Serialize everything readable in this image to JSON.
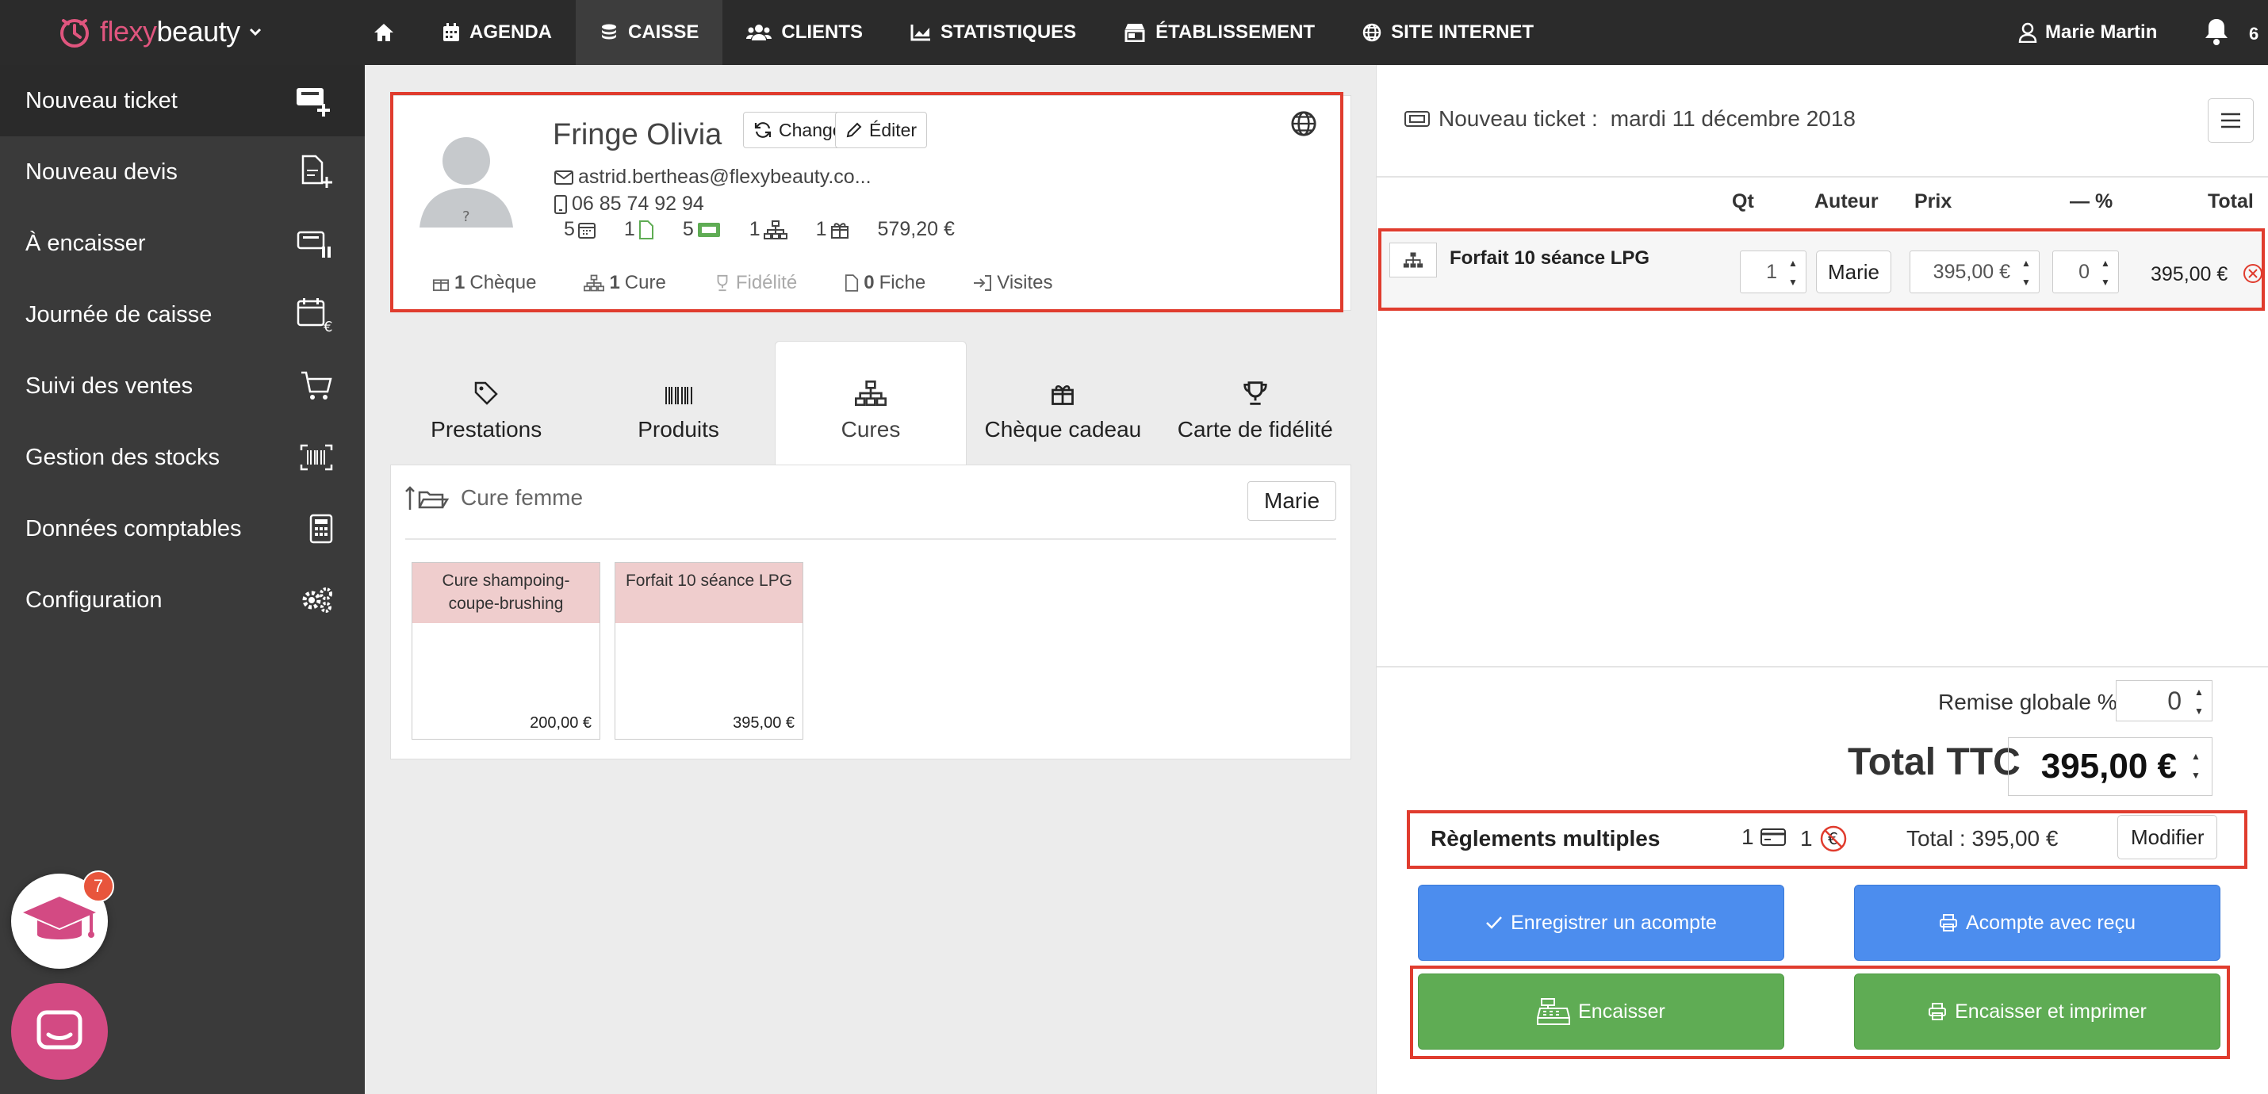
{
  "brand": {
    "logo_text_accent": "flexy",
    "logo_text_main": "beauty"
  },
  "nav": {
    "items": [
      {
        "label": "",
        "icon": "home-icon"
      },
      {
        "label": "AGENDA",
        "icon": "calendar-icon"
      },
      {
        "label": "CAISSE",
        "icon": "coins-icon",
        "active": true
      },
      {
        "label": "CLIENTS",
        "icon": "users-icon"
      },
      {
        "label": "STATISTIQUES",
        "icon": "chart-icon"
      },
      {
        "label": "ÉTABLISSEMENT",
        "icon": "store-icon"
      },
      {
        "label": "SITE INTERNET",
        "icon": "globe-icon"
      }
    ]
  },
  "user": {
    "name": "Marie Martin",
    "notifications": "6"
  },
  "sidebar": {
    "items": [
      {
        "label": "Nouveau ticket"
      },
      {
        "label": "Nouveau devis"
      },
      {
        "label": "À encaisser"
      },
      {
        "label": "Journée de caisse"
      },
      {
        "label": "Suivi des ventes"
      },
      {
        "label": "Gestion des stocks"
      },
      {
        "label": "Données comptables"
      },
      {
        "label": "Configuration"
      }
    ]
  },
  "client": {
    "name": "Fringe Olivia",
    "change_label": "Changer",
    "edit_label": "Éditer",
    "email": "astrid.bertheas@flexybeauty.co...",
    "phone": "06 85 74 92 94",
    "stats": {
      "appointments": "5",
      "documents": "1",
      "tickets": "5",
      "cures": "1",
      "gifts": "1",
      "amount": "579,20 €"
    },
    "links": {
      "cheque_count": "1",
      "cheque": "Chèque",
      "cure_count": "1",
      "cure": "Cure",
      "fidelite": "Fidélité",
      "fiche_count": "0",
      "fiche": "Fiche",
      "visites": "Visites"
    }
  },
  "tabs": [
    {
      "label": "Prestations"
    },
    {
      "label": "Produits"
    },
    {
      "label": "Cures"
    },
    {
      "label": "Chèque cadeau"
    },
    {
      "label": "Carte de fidélité"
    }
  ],
  "cures": {
    "folder": "Cure femme",
    "staff": "Marie",
    "products": [
      {
        "name": "Cure shampoing-coupe-brushing",
        "price": "200,00 €"
      },
      {
        "name": "Forfait 10 séance LPG",
        "price": "395,00 €"
      }
    ]
  },
  "ticket": {
    "title": "Nouveau ticket :",
    "date": "mardi 11 décembre 2018",
    "columns": {
      "qt": "Qt",
      "auteur": "Auteur",
      "prix": "Prix",
      "remise": "— %",
      "total": "Total"
    },
    "lines": [
      {
        "name": "Forfait 10 séance LPG",
        "qty": "1",
        "author": "Marie",
        "price": "395,00 €",
        "discount": "0",
        "total": "395,00 €"
      }
    ],
    "remise_label": "Remise globale %",
    "remise_value": "0",
    "total_label": "Total TTC",
    "total_value": "395,00 €",
    "reglements": {
      "label": "Règlements multiples",
      "card_count": "1",
      "no_cash_count": "1",
      "total": "Total : 395,00 €",
      "modify": "Modifier"
    },
    "buttons": {
      "acompte": "Enregistrer un acompte",
      "acompte_recu": "Acompte avec reçu",
      "encaisser": "Encaisser",
      "encaisser_imprimer": "Encaisser et imprimer"
    }
  },
  "help_badge": "7",
  "colors": {
    "accent": "#e0557e",
    "highlight": "#e03c2e",
    "blue": "#4c8dee",
    "green": "#5fac54",
    "product_tile": "#efcdcd"
  }
}
